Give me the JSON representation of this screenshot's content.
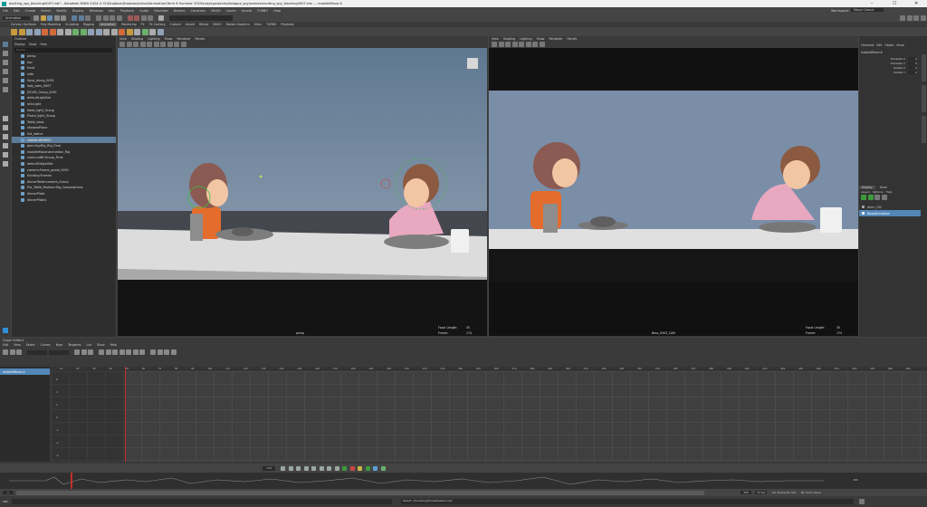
{
  "window": {
    "title": "exciting_spy_blocking0007.mb* - Autodesk MAYA 2024.2: D:\\Dropbox\\Dropbox\\school\\Animation\\Term 6 Summer 2024\\maya\\projects\\dialogue_spy\\scenes\\exciting_spy_blocking0007.mb --- mobiletMove.X",
    "controls": [
      "–",
      "☐",
      "✕"
    ]
  },
  "menubar": {
    "items": [
      "File",
      "Edit",
      "Create",
      "Select",
      "Modify",
      "Display",
      "Windows",
      "Key",
      "Playback",
      "Audio",
      "Visualize",
      "Deform",
      "Constrain",
      "MASH",
      "Cache",
      "Arnold",
      "TURBO",
      "Help"
    ],
    "mode": "Animation",
    "workspace_label": "Workspace:",
    "workspace_value": "Maya Classic"
  },
  "shelf": {
    "tabs": [
      "Curves / Surfaces",
      "Poly Modeling",
      "Sculpting",
      "Rigging",
      "Animation",
      "Rendering",
      "FX",
      "FX Caching",
      "Custom",
      "Arnold",
      "Bifrost",
      "MASH",
      "Motion Graphics",
      "XGen",
      "TURBO",
      "Playblast"
    ],
    "active_tab": "Animation"
  },
  "outliner": {
    "title": "Outliner",
    "menu": [
      "Display",
      "Show",
      "Help"
    ],
    "search_placeholder": "Search...",
    "items": [
      "persp",
      "top",
      "front",
      "side",
      "Sava_dinng_0001",
      "lady_toes_0007",
      "JSOGE_Group_0001",
      "defaultLightSet",
      "skinLight",
      "table_light_Group",
      "Pirate_light_Group",
      "Table_base",
      "shadowPlane",
      "kid_lattice",
      "charlie:HD0001",
      "gem:SpyRig_Rig_Final",
      "mobiletMove:animation_Rig",
      "carlo:outfit:Group_Final",
      "defaultObjectSet",
      "camera:Frame_guide_0001",
      "Exciting:Frames",
      "dinnerTable:camera_Group",
      "Pro_Table_Fashion:Rig_Compositions",
      "dinnerPlate",
      "dinnerPlate1"
    ],
    "selected_index": 14
  },
  "viewport_left": {
    "menu": [
      "View",
      "Shading",
      "Lighting",
      "Show",
      "Renderer",
      "Panels"
    ],
    "camera_label": "persp",
    "hud_focal_label": "Focal Length:",
    "hud_focal_value": "35",
    "hud_frame_label": "Frame:",
    "hud_frame_value": "174"
  },
  "viewport_right": {
    "menu": [
      "View",
      "Shading",
      "Lighting",
      "Show",
      "Renderer",
      "Panels"
    ],
    "camera_label": "Boss_0003_CAM",
    "hud_focal_label": "Focal Length:",
    "hud_focal_value": "35",
    "hud_frame_label": "Frame:",
    "hud_frame_value": "174"
  },
  "channel_box": {
    "tabs": [
      "Channels",
      "Edit",
      "Object",
      "Show"
    ],
    "object_name": "mobiletMove:X",
    "attributes": [
      {
        "name": "Translate X",
        "value": "0"
      },
      {
        "name": "Translate Y",
        "value": "0"
      },
      {
        "name": "Rotate X",
        "value": "0"
      },
      {
        "name": "Rotate Y",
        "value": "0"
      }
    ]
  },
  "layer_editor": {
    "tabs": [
      "Display",
      "Anim"
    ],
    "menu": [
      "Layers",
      "Options",
      "Help"
    ],
    "layers": [
      {
        "name": "Anim_CW",
        "selected": false
      },
      {
        "name": "BaseAnimation",
        "selected": true
      }
    ]
  },
  "graph_editor": {
    "title": "Graph Editor1",
    "menu": [
      "Edit",
      "View",
      "Select",
      "Curves",
      "Keys",
      "Tangents",
      "List",
      "Show",
      "Help"
    ],
    "outline_item": "mobiletMove:X",
    "ruler_labels": [
      "10",
      "20",
      "30",
      "40",
      "50",
      "60",
      "70",
      "80",
      "90",
      "100",
      "110",
      "120",
      "130",
      "140",
      "150",
      "160",
      "170",
      "180",
      "190",
      "200",
      "210",
      "220",
      "230",
      "240",
      "250",
      "260",
      "270",
      "280",
      "290",
      "300",
      "310",
      "320",
      "330",
      "340",
      "350",
      "360",
      "370",
      "380",
      "390",
      "400",
      "410",
      "420",
      "430",
      "440",
      "450",
      "460",
      "470",
      "480",
      "490"
    ],
    "value_labels": [
      "6",
      "4",
      "2",
      "0",
      "-2",
      "-4",
      "-6"
    ]
  },
  "timeline": {
    "start": "1",
    "end": "490",
    "fps": "24 fps",
    "current_frame": "174",
    "character_set": "No Character Set",
    "anim_layer": "No Anim Layer"
  },
  "command_line": {
    "lang": "MEL",
    "text": "Result: //Scripting/Tools/Pipeline.mel"
  },
  "colors": {
    "maya_blue": "#5d7c99",
    "viewport_bg": "#7a8fa8",
    "accent_green": "#3c9a3c"
  }
}
